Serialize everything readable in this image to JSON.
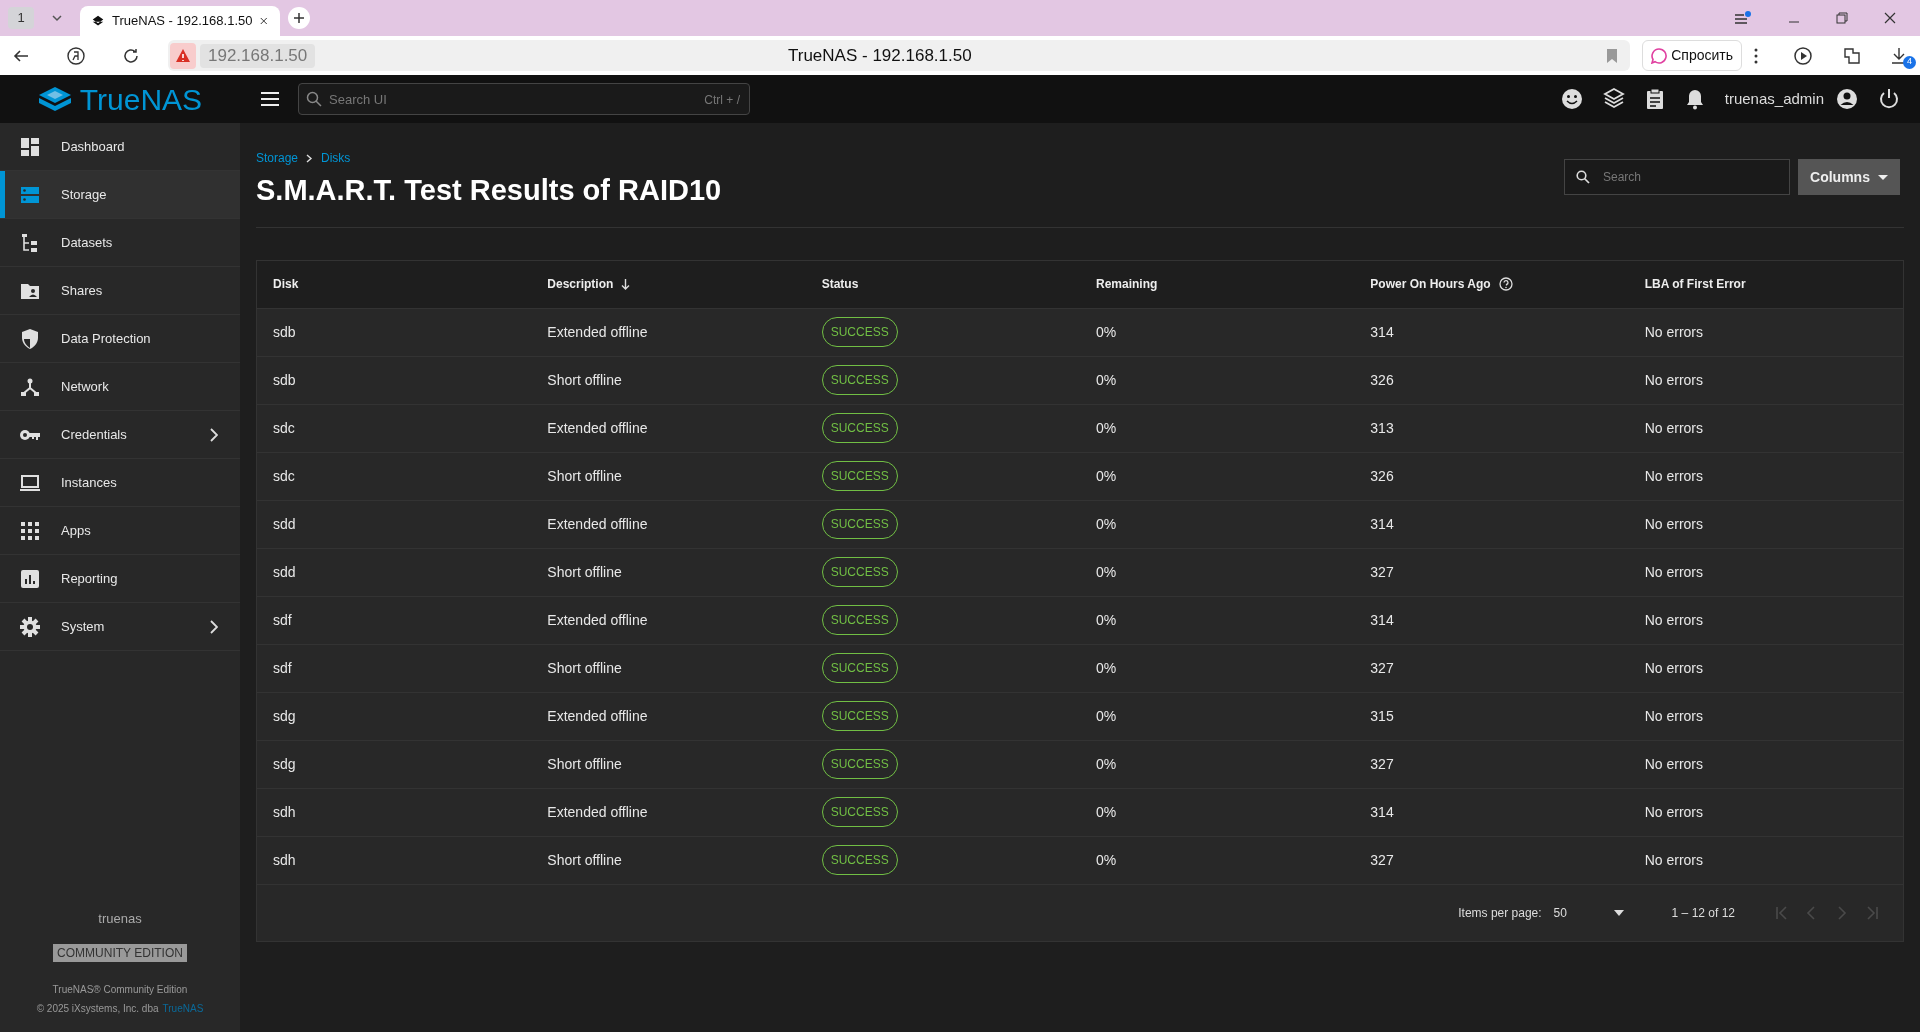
{
  "browser": {
    "tab_count": "1",
    "tab_title": "TrueNAS - 192.168.1.50",
    "address": "192.168.1.50",
    "page_title": "TrueNAS - 192.168.1.50",
    "ask_button": "Спросить",
    "downloads_badge": "4"
  },
  "header": {
    "logo": "TrueNAS",
    "search": {
      "placeholder": "Search UI",
      "shortcut": "Ctrl + /"
    },
    "username": "truenas_admin"
  },
  "sidebar": {
    "items": [
      {
        "label": "Dashboard",
        "selected": false,
        "has_submenu": false
      },
      {
        "label": "Storage",
        "selected": true,
        "has_submenu": false
      },
      {
        "label": "Datasets",
        "selected": false,
        "has_submenu": false
      },
      {
        "label": "Shares",
        "selected": false,
        "has_submenu": false
      },
      {
        "label": "Data Protection",
        "selected": false,
        "has_submenu": false
      },
      {
        "label": "Network",
        "selected": false,
        "has_submenu": false
      },
      {
        "label": "Credentials",
        "selected": false,
        "has_submenu": true
      },
      {
        "label": "Instances",
        "selected": false,
        "has_submenu": false
      },
      {
        "label": "Apps",
        "selected": false,
        "has_submenu": false
      },
      {
        "label": "Reporting",
        "selected": false,
        "has_submenu": false
      },
      {
        "label": "System",
        "selected": false,
        "has_submenu": true
      }
    ],
    "hostname": "truenas",
    "edition_badge": "COMMUNITY EDITION",
    "product": "TrueNAS® Community Edition",
    "copyright": "© 2025 iXsystems, Inc. dba",
    "copyright_link": "TrueNAS"
  },
  "breadcrumbs": [
    "Storage",
    "Disks"
  ],
  "page_title": "S.M.A.R.T. Test Results of RAID10",
  "search": {
    "placeholder": "Search"
  },
  "columns_button": "Columns",
  "table": {
    "columns": [
      {
        "label": "Disk"
      },
      {
        "label": "Description",
        "sorted": true
      },
      {
        "label": "Status"
      },
      {
        "label": "Remaining"
      },
      {
        "label": "Power On Hours Ago",
        "help": true
      },
      {
        "label": "LBA of First Error"
      }
    ],
    "rows": [
      [
        "sdb",
        "Extended offline",
        "SUCCESS",
        "0%",
        "314",
        "No errors"
      ],
      [
        "sdb",
        "Short offline",
        "SUCCESS",
        "0%",
        "326",
        "No errors"
      ],
      [
        "sdc",
        "Extended offline",
        "SUCCESS",
        "0%",
        "313",
        "No errors"
      ],
      [
        "sdc",
        "Short offline",
        "SUCCESS",
        "0%",
        "326",
        "No errors"
      ],
      [
        "sdd",
        "Extended offline",
        "SUCCESS",
        "0%",
        "314",
        "No errors"
      ],
      [
        "sdd",
        "Short offline",
        "SUCCESS",
        "0%",
        "327",
        "No errors"
      ],
      [
        "sdf",
        "Extended offline",
        "SUCCESS",
        "0%",
        "314",
        "No errors"
      ],
      [
        "sdf",
        "Short offline",
        "SUCCESS",
        "0%",
        "327",
        "No errors"
      ],
      [
        "sdg",
        "Extended offline",
        "SUCCESS",
        "0%",
        "315",
        "No errors"
      ],
      [
        "sdg",
        "Short offline",
        "SUCCESS",
        "0%",
        "327",
        "No errors"
      ],
      [
        "sdh",
        "Extended offline",
        "SUCCESS",
        "0%",
        "314",
        "No errors"
      ],
      [
        "sdh",
        "Short offline",
        "SUCCESS",
        "0%",
        "327",
        "No errors"
      ]
    ]
  },
  "pagination": {
    "label": "Items per page:",
    "page_size": "50",
    "range": "1 – 12 of 12",
    "buttons": [
      {
        "kind": "first",
        "disabled": true
      },
      {
        "kind": "prev",
        "disabled": true
      },
      {
        "kind": "next",
        "disabled": true
      },
      {
        "kind": "last",
        "disabled": true
      }
    ]
  }
}
